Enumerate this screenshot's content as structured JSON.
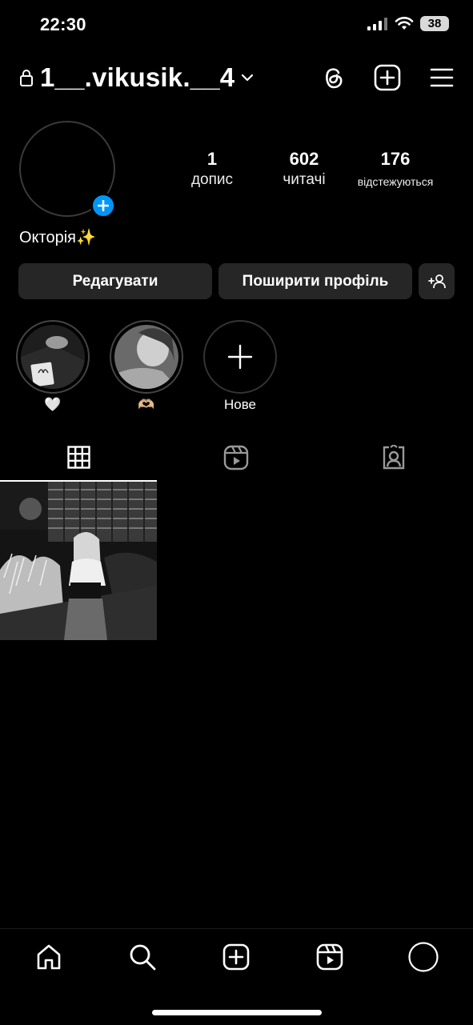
{
  "status_bar": {
    "time": "22:30",
    "battery": "38"
  },
  "header": {
    "username": "1__.vikusik.__4"
  },
  "profile": {
    "stats": [
      {
        "value": "1",
        "label": "допис"
      },
      {
        "value": "602",
        "label": "читачі"
      },
      {
        "value": "176",
        "label": "відстежуються"
      }
    ],
    "display_name": "Окторія✨"
  },
  "buttons": {
    "edit": "Редагувати",
    "share": "Поширити профіль"
  },
  "highlights": [
    {
      "label": "🤍"
    },
    {
      "label": "🫶🏼"
    },
    {
      "label": "Нове"
    }
  ],
  "colors": {
    "background": "#000000",
    "button": "#262626",
    "accent": "#0095f6"
  }
}
